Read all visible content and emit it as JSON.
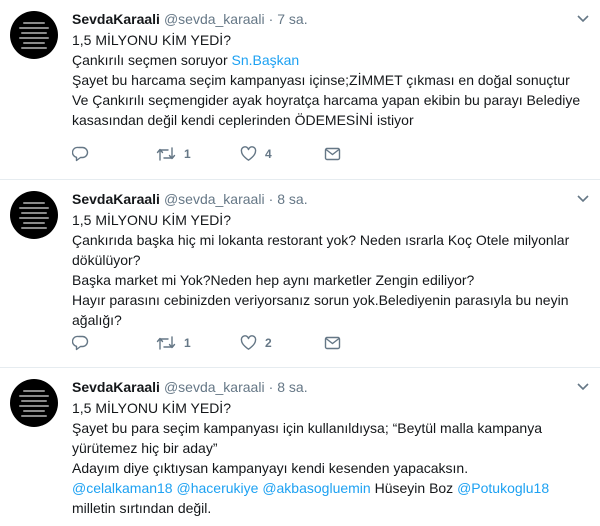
{
  "tweets": [
    {
      "name": "SevdaKaraali",
      "handle": "@sevda_karaali",
      "separator": "·",
      "time": "7 sa.",
      "lines": [
        "1,5 MİLYONU KİM YEDİ?",
        "Şayet bu harcama seçim kampanyası içinse;ZİMMET çıkması en doğal sonuçtur",
        "Ve Çankırılı seçmengider ayak hoyratça harcama yapan ekibin bu parayı Belediye kasasından değil kendi ceplerinden ÖDEMESİNİ istiyor"
      ],
      "line2_prefix": "Çankırılı seçmen soruyor ",
      "line2_link": "Sn.Başkan",
      "reply_count": "",
      "retweet_count": "1",
      "like_count": "4"
    },
    {
      "name": "SevdaKaraali",
      "handle": "@sevda_karaali",
      "separator": "·",
      "time": "8 sa.",
      "lines": [
        "1,5 MİLYONU KİM YEDİ?",
        "Çankırıda başka hiç mi lokanta restorant yok? Neden ısrarla Koç Otele milyonlar dökülüyor?",
        "Başka market mi Yok?Neden hep aynı marketler Zengin ediliyor?",
        "Hayır parasını cebinizden veriyorsanız sorun yok.Belediyenin parasıyla bu neyin ağalığı?"
      ],
      "reply_count": "",
      "retweet_count": "1",
      "like_count": "2"
    },
    {
      "name": "SevdaKaraali",
      "handle": "@sevda_karaali",
      "separator": "·",
      "time": "8 sa.",
      "lines": [
        "1,5 MİLYONU KİM YEDİ?",
        "Şayet bu para seçim kampanyası için kullanıldıysa; “Beytül malla kampanya yürütemez hiç bir aday”",
        "Adayım diye çıktıysan kampanyayı kendi kesenden yapacaksın."
      ],
      "mentions": [
        "@celalkaman18",
        "@hacerukiye",
        "@akbasogluemin"
      ],
      "plain_name": "Hüseyin Boz",
      "mention_last": "@Potukoglu18",
      "closing": "milletin sırtından değil."
    }
  ],
  "colors": {
    "link": "#1da1f2",
    "muted": "#657786",
    "text": "#14171a",
    "divider": "#e6ecf0"
  },
  "icons": [
    "reply-icon",
    "retweet-icon",
    "like-icon",
    "dm-icon",
    "chevron-down-icon"
  ]
}
